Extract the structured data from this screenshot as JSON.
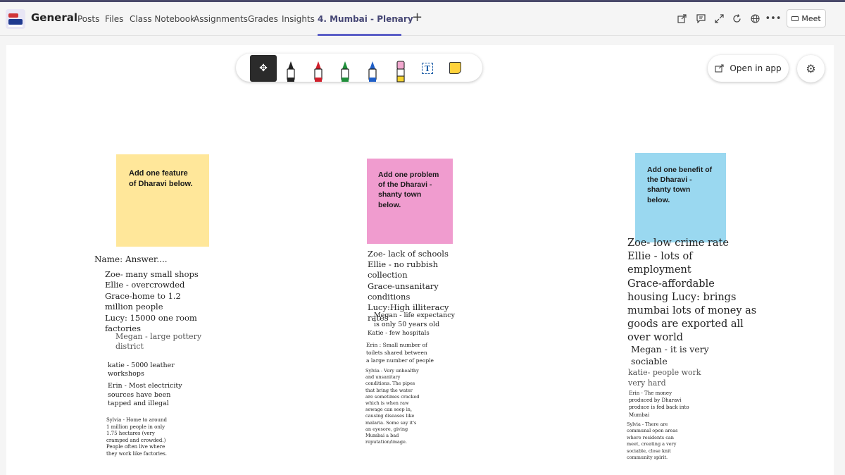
{
  "header": {
    "channel_name": "General",
    "tabs": [
      "Posts",
      "Files",
      "Class Notebook",
      "Assignments",
      "Grades",
      "Insights",
      "4. Mumbai - Plenary"
    ],
    "meet_label": "Meet"
  },
  "toolbar": {
    "open_in_app": "Open in app",
    "textbox_glyph": "T"
  },
  "stickies": {
    "feature": "Add one feature of Dharavi below.",
    "problem": "Add one problem of the Dharavi - shanty town below.",
    "benefit": "Add one benefit of the Dharavi - shanty town below."
  },
  "column1": {
    "name_answer": "Name: Answer....",
    "zoe": "Zoe- many small shops\nEllie - overcrowded\nGrace-home to 1.2\nmillion people\nLucy: 15000 one room\nfactories",
    "megan": "Megan - large pottery\ndistrict",
    "katie": "katie - 5000 leather\nworkshops",
    "erin": "Erin - Most electricity\nsources have been\ntapped and illegal",
    "sylvia": "Sylvia - Home to around\n1 million people in only\n1.75 hectares (very\ncramped and crowded.)\nPeople often live where\nthey work like factories."
  },
  "column2": {
    "zoe": "Zoe- lack of schools\nEllie - no rubbish\ncollection\nGrace-unsanitary\nconditions\nLucy:High illiteracy\nrates",
    "megan": "Megan - life expectancy\nis only 50 years old",
    "katie": "Katie - few hospitals",
    "erin": "Erin : Small number of\ntoilets shared between\na large number of people",
    "sylvia": "Sylvia - Very unhealthy\nand unsanitary\nconditions. The pipes\nthat bring the water\nare sometimes cracked\nwhich is when raw\nsewage can seep in,\ncausing diseases like\nmalaria. Some say it's\nan eyesore, giving\nMumbai a bad\nreputation/image."
  },
  "column3": {
    "zoe": "Zoe- low crime rate\nEllie - lots of\nemployment\nGrace-affordable\nhousing Lucy: brings\nmumbai lots of money as\ngoods are exported all\nover world",
    "megan": "Megan - it is very\nsociable",
    "katie": "katie- people work\nvery hard",
    "erin": "Erin - The money\nproduced by Dharavi\nproduce is fed back into\nMumbai",
    "sylvia": "Sylvia - There are\ncommunal open areas\nwhere residents can\nmeet, creating a very\nsociable, close knit\ncommunity spirit."
  }
}
